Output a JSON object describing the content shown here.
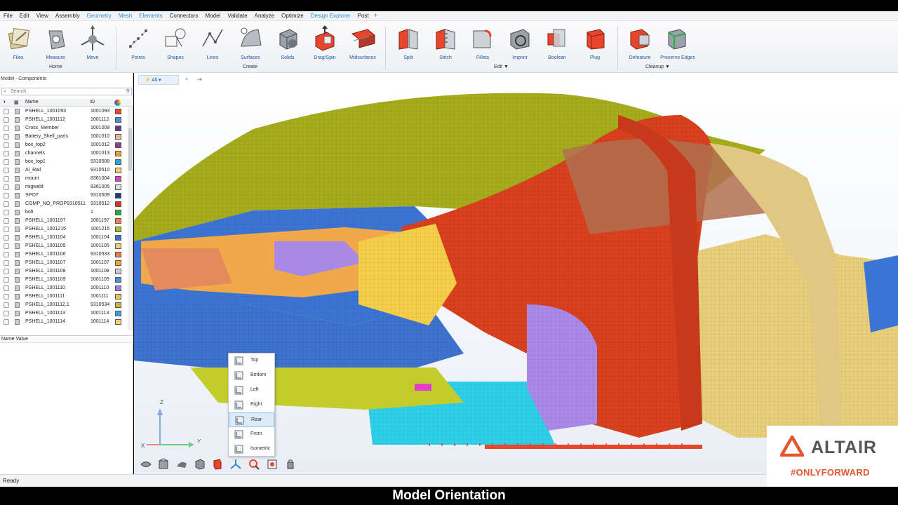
{
  "menu": {
    "items": [
      {
        "label": "File",
        "active": false
      },
      {
        "label": "Edit",
        "active": false
      },
      {
        "label": "View",
        "active": false
      },
      {
        "label": "Assembly",
        "active": false
      },
      {
        "label": "Geometry",
        "active": true
      },
      {
        "label": "Mesh",
        "active": true
      },
      {
        "label": "Elements",
        "active": true
      },
      {
        "label": "Connectors",
        "active": false
      },
      {
        "label": "Model",
        "active": false
      },
      {
        "label": "Validate",
        "active": false
      },
      {
        "label": "Analyze",
        "active": false
      },
      {
        "label": "Optimize",
        "active": false
      },
      {
        "label": "Design Explorer",
        "active": true
      },
      {
        "label": "Post",
        "active": false
      }
    ],
    "plus": "+"
  },
  "ribbon": {
    "tools": {
      "files": "Files",
      "measure": "Measure",
      "move": "Move",
      "points": "Points",
      "shapes": "Shapes",
      "lines": "Lines",
      "surfaces": "Surfaces",
      "solids": "Solids",
      "dragspin": "Drag/Spin",
      "midsurfaces": "Midsurfaces",
      "split": "Split",
      "stitch": "Stitch",
      "fillets": "Fillets",
      "imprint": "Imprint",
      "boolean": "Boolean",
      "plug": "Plug",
      "defeature": "Defeature",
      "preserve_edges": "Preserve Edges"
    },
    "groups": {
      "home": "Home",
      "create": "Create",
      "edit": "Edit",
      "cleanup": "Cleanup"
    },
    "dropdown_arrow": "▼"
  },
  "panel": {
    "title": "Model - Components",
    "search_placeholder": "Search",
    "col_name": "Name",
    "col_id": "ID",
    "rows": [
      {
        "name": "PSHELL_1001093",
        "id": "1001093",
        "color": "#e8452c"
      },
      {
        "name": "PSHELL_1001112",
        "id": "1001112",
        "color": "#4a8fe0"
      },
      {
        "name": "Cross_Member",
        "id": "1001009",
        "color": "#5a3f8c"
      },
      {
        "name": "Battery_Shell_parts",
        "id": "1001010",
        "color": "#e7b9a0"
      },
      {
        "name": "box_top2",
        "id": "1001012",
        "color": "#8a3f8c"
      },
      {
        "name": "channels",
        "id": "1001013",
        "color": "#f0a030"
      },
      {
        "name": "box_top1",
        "id": "9310508",
        "color": "#2aa7d8"
      },
      {
        "name": "Al_Rail",
        "id": "9310510",
        "color": "#f4d370"
      },
      {
        "name": "mount",
        "id": "8361004",
        "color": "#e040c8"
      },
      {
        "name": "migweld",
        "id": "8361005",
        "color": "#e0e0e0"
      },
      {
        "name": "SPOT",
        "id": "9310509",
        "color": "#223a8a"
      },
      {
        "name": "COMP_NO_PROP9310511",
        "id": "9310512",
        "color": "#e03020"
      },
      {
        "name": "bolt",
        "id": "1",
        "color": "#20b040"
      },
      {
        "name": "PSHELL_1001197",
        "id": "1001197",
        "color": "#f08050"
      },
      {
        "name": "PSHELL_1001215",
        "id": "1001215",
        "color": "#a8c020"
      },
      {
        "name": "PSHELL_1001104",
        "id": "1001104",
        "color": "#3a70d0"
      },
      {
        "name": "PSHELL_1001105",
        "id": "1001105",
        "color": "#f0d080"
      },
      {
        "name": "PSHELL_1001106",
        "id": "9310533",
        "color": "#f07a40"
      },
      {
        "name": "PSHELL_1001107",
        "id": "1001107",
        "color": "#f0a830"
      },
      {
        "name": "PSHELL_1001108",
        "id": "1001108",
        "color": "#d0d0d0"
      },
      {
        "name": "PSHELL_1001109",
        "id": "1001109",
        "color": "#4a8fe0"
      },
      {
        "name": "PSHELL_1001110",
        "id": "1001110",
        "color": "#a080e0"
      },
      {
        "name": "PSHELL_1001111",
        "id": "1001111",
        "color": "#f0c060"
      },
      {
        "name": "PSHELL_1001112.1",
        "id": "9310534",
        "color": "#c8b830"
      },
      {
        "name": "PSHELL_1001113",
        "id": "1001113",
        "color": "#3aa0e0"
      },
      {
        "name": "PSHELL_1001114",
        "id": "1001114",
        "color": "#f0d080"
      }
    ],
    "name_value": "Name Value"
  },
  "viewport": {
    "selector_label": "All",
    "view_menu": [
      {
        "label": "Top",
        "hover": false
      },
      {
        "label": "Bottom",
        "hover": false
      },
      {
        "label": "Left",
        "hover": false
      },
      {
        "label": "Right",
        "hover": false
      },
      {
        "label": "Rear",
        "hover": true
      },
      {
        "label": "Front",
        "hover": false
      },
      {
        "label": "Isometric",
        "hover": false
      }
    ],
    "axes": {
      "z": "Z",
      "y": "Y",
      "x": "X"
    }
  },
  "status": {
    "text": "Ready"
  },
  "caption": "Model Orientation",
  "brand": {
    "name": "ALTAIR",
    "tagline": "#ONLYFORWARD",
    "accent": "#e4572e",
    "blue": "#1c5aa6"
  },
  "icons": {
    "ribbon": [
      "files-icon",
      "measure-icon",
      "move-icon",
      "points-icon",
      "shapes-icon",
      "lines-icon",
      "surfaces-icon",
      "solids-icon",
      "dragspin-icon",
      "midsurfaces-icon",
      "split-icon",
      "stitch-icon",
      "fillets-icon",
      "imprint-icon",
      "boolean-icon",
      "plug-icon",
      "defeature-icon",
      "preserve-edges-icon"
    ],
    "bottom": [
      "display-mode-icon",
      "view-cube-icon",
      "shading-icon",
      "box-icon",
      "clip-icon",
      "view-orientation-icon",
      "zoom-icon",
      "fit-icon",
      "visibility-icon"
    ]
  }
}
